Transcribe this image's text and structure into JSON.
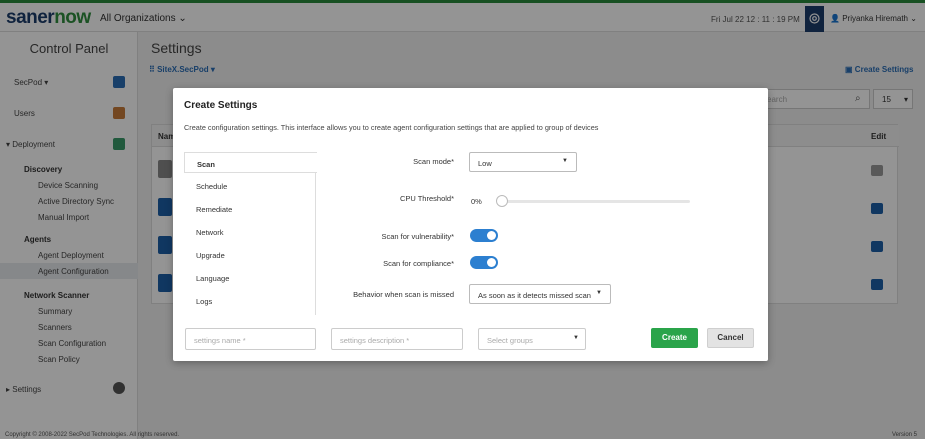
{
  "header": {
    "logo_main": "saner",
    "logo_accent": "now",
    "org_selector": "All Organizations",
    "datetime": "Fri Jul 22  12 : 11 : 19 PM",
    "user_name": "Priyanka Hiremath"
  },
  "sidebar": {
    "title": "Control Panel",
    "site_selector": "SecPod",
    "users": "Users",
    "deployment": "Deployment",
    "discovery": "Discovery",
    "device_scanning": "Device Scanning",
    "ad_sync": "Active Directory Sync",
    "manual_import": "Manual Import",
    "agents": "Agents",
    "agent_deployment": "Agent Deployment",
    "agent_configuration": "Agent Configuration",
    "network_scanner": "Network Scanner",
    "summary": "Summary",
    "scanners": "Scanners",
    "scan_configuration": "Scan Configuration",
    "scan_policy": "Scan Policy",
    "settings": "Settings"
  },
  "page": {
    "title": "Settings",
    "site": "SiteX.SecPod",
    "create_settings": "Create Settings",
    "search_placeholder": "earch",
    "page_size": "15",
    "col_name": "Nam",
    "col_edit": "Edit"
  },
  "footer": {
    "copyright": "Copyright © 2008-2022 SecPod Technologies. All rights reserved.",
    "version": "Version 5"
  },
  "modal": {
    "title": "Create Settings",
    "description": "Create configuration settings. This interface allows you to create agent configuration settings that are applied to group of devices",
    "tabs": [
      "Scan",
      "Schedule",
      "Remediate",
      "Network",
      "Upgrade",
      "Language",
      "Logs"
    ],
    "scan_mode_label": "Scan mode*",
    "scan_mode_value": "Low",
    "cpu_label": "CPU Threshold*",
    "cpu_value": "0%",
    "cpu_level": 0,
    "vuln_label": "Scan for vulnerability*",
    "vuln_on": true,
    "compliance_label": "Scan for compliance*",
    "compliance_on": true,
    "missed_label": "Behavior when scan is missed",
    "missed_value": "As soon as it detects missed scan",
    "name_placeholder": "settings name *",
    "desc_placeholder": "settings description *",
    "group_placeholder": "Select groups",
    "create_button": "Create",
    "cancel_button": "Cancel"
  },
  "colors": {
    "brand_blue": "#1d3d6b",
    "brand_green": "#2f8d3e",
    "create_green": "#2aa44a",
    "toggle_blue": "#2c7fd0"
  }
}
